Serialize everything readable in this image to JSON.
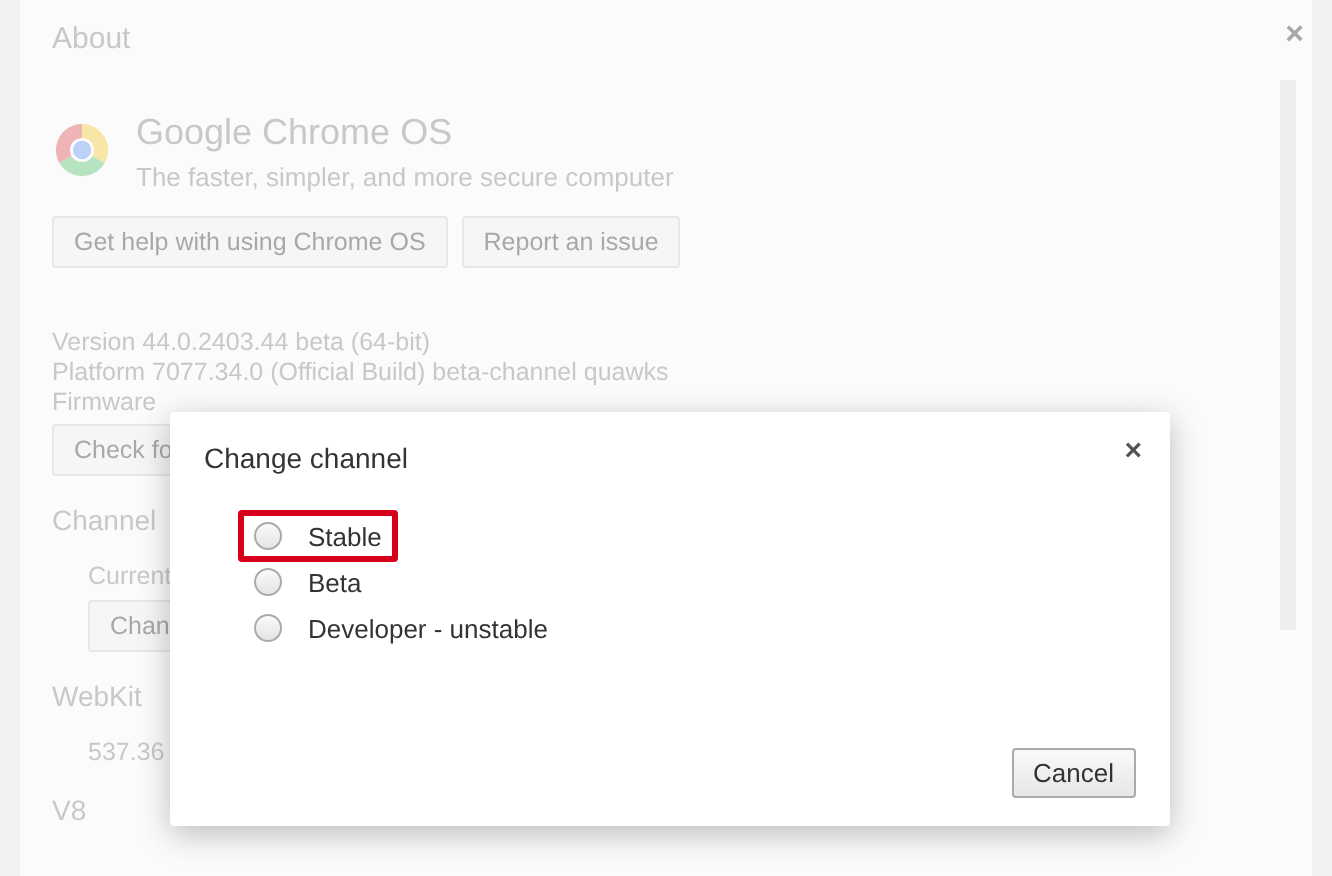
{
  "about": {
    "title": "About",
    "close": "×",
    "product": {
      "name": "Google Chrome OS",
      "tagline": "The faster, simpler, and more secure computer"
    },
    "help_buttons": [
      "Get help with using Chrome OS",
      "Report an issue"
    ],
    "version_lines": [
      "Version 44.0.2403.44 beta (64-bit)",
      "Platform 7077.34.0 (Official Build) beta-channel quawks",
      "Firmware"
    ],
    "check_button": "Check fo",
    "sections": [
      {
        "heading": "Channel",
        "text": "Current",
        "button": "Chan"
      },
      {
        "heading": "WebKit",
        "text": "537.36"
      },
      {
        "heading": "V8"
      }
    ]
  },
  "dialog": {
    "title": "Change channel",
    "close": "×",
    "options": [
      {
        "label": "Stable",
        "selected": false,
        "highlighted": true
      },
      {
        "label": "Beta",
        "selected": false,
        "highlighted": false
      },
      {
        "label": "Developer - unstable",
        "selected": false,
        "highlighted": false
      }
    ],
    "cancel": "Cancel"
  }
}
